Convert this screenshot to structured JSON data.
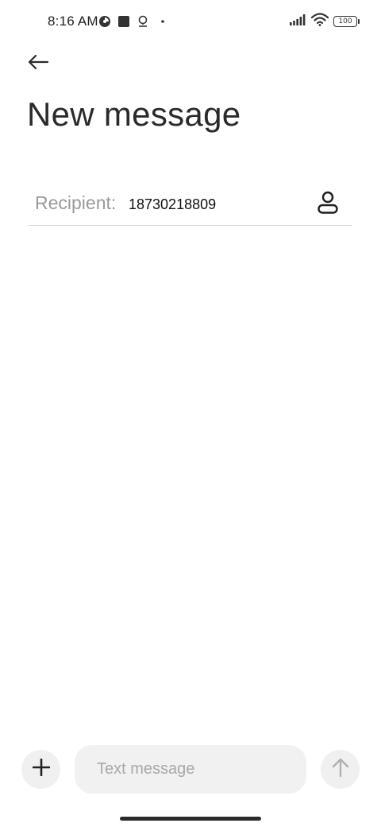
{
  "status_bar": {
    "time": "8:16 AM",
    "left_icons": [
      "timer-icon",
      "square-icon",
      "location-icon",
      "dot-icon"
    ],
    "right_icons": [
      "signal-icon",
      "wifi-icon",
      "battery-icon"
    ],
    "battery_level": "100"
  },
  "header": {
    "back_icon": "arrow-left-icon",
    "title": "New message"
  },
  "recipient": {
    "label": "Recipient:",
    "value": "18730218809",
    "contact_icon": "person-icon"
  },
  "compose": {
    "attach_icon": "plus-icon",
    "placeholder": "Text message",
    "send_icon": "arrow-up-icon"
  }
}
